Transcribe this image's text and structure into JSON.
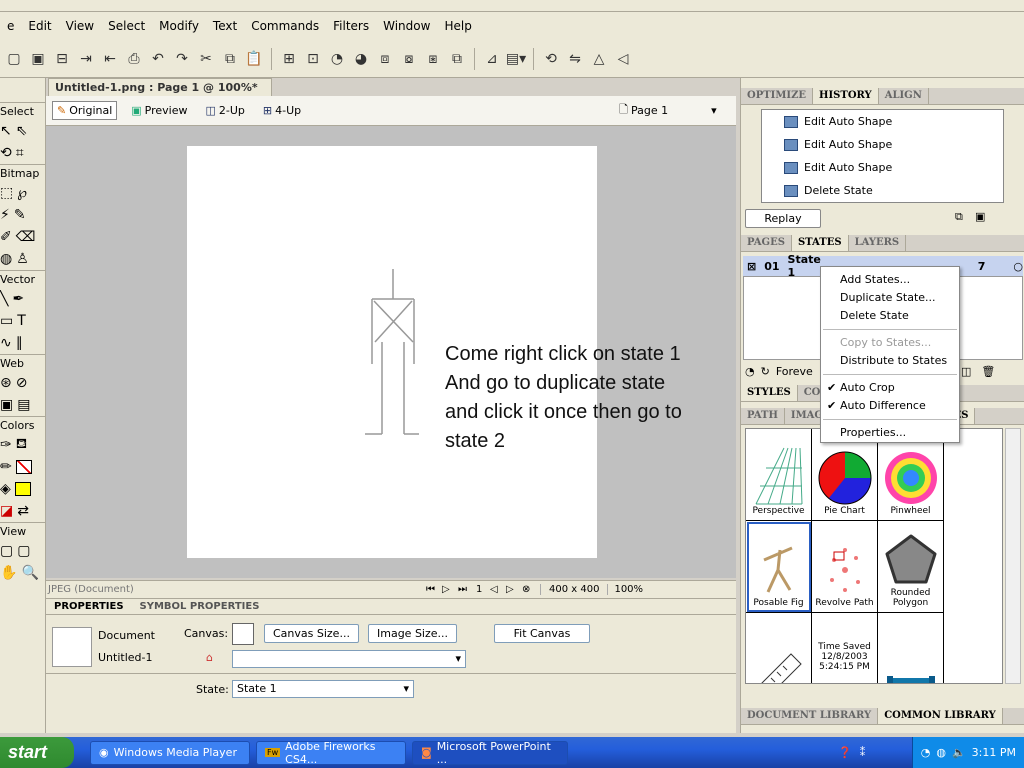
{
  "menu": [
    "e",
    "Edit",
    "View",
    "Select",
    "Modify",
    "Text",
    "Commands",
    "Filters",
    "Window",
    "Help"
  ],
  "document": {
    "tab_title": "Untitled-1.png : Page 1 @ 100%*",
    "close": "×",
    "view_original": "Original",
    "view_preview": "Preview",
    "view_2up": "2-Up",
    "view_4up": "4-Up",
    "page_selector": "Page 1"
  },
  "tools": {
    "select": "Select",
    "bitmap": "Bitmap",
    "vector": "Vector",
    "web": "Web",
    "colors": "Colors",
    "view": "View"
  },
  "annotation": [
    "Come right click on state 1",
    "And go to duplicate state",
    "and click it once then go to",
    "state 2"
  ],
  "status": {
    "format": "JPEG (Document)",
    "frame": "1",
    "size": "400 x 400",
    "zoom": "100%"
  },
  "properties": {
    "tab1": "PROPERTIES",
    "tab2": "SYMBOL PROPERTIES",
    "doc_label": "Document",
    "doc_name": "Untitled-1",
    "canvas_label": "Canvas:",
    "canvas_size_btn": "Canvas Size...",
    "image_size_btn": "Image Size...",
    "fit_canvas_btn": "Fit Canvas",
    "state_label": "State:",
    "state_value": "State 1"
  },
  "history_panel": {
    "tabs": [
      "OPTIMIZE",
      "HISTORY",
      "ALIGN"
    ],
    "active_tab": "HISTORY",
    "items": [
      "Edit Auto Shape",
      "Edit Auto Shape",
      "Edit Auto Shape",
      "Delete State"
    ],
    "replay": "Replay"
  },
  "states_panel": {
    "tabs": [
      "PAGES",
      "STATES",
      "LAYERS"
    ],
    "active_tab": "STATES",
    "state_num": "01",
    "state_name": "State 1",
    "delay": "7",
    "loop": "Foreve"
  },
  "styles_panel": {
    "tabs": [
      "STYLES",
      "COL"
    ]
  },
  "library_panel": {
    "tabs": [
      "PATH",
      "IMAGE",
      "ES"
    ],
    "items": [
      "Perspective",
      "Pie Chart",
      "Pinwheel",
      "Posable Fig",
      "Revolve Path",
      "Rounded Polygon",
      "",
      "Time Saved 12/8/2003 5:24:15 PM",
      ""
    ],
    "bottom_tabs": [
      "DOCUMENT LIBRARY",
      "COMMON LIBRARY"
    ]
  },
  "context_menu": [
    {
      "label": "Add States...",
      "disabled": false,
      "checked": false
    },
    {
      "label": "Duplicate State...",
      "disabled": false,
      "checked": false
    },
    {
      "label": "Delete State",
      "disabled": false,
      "checked": false
    },
    {
      "label": "Copy to States...",
      "disabled": true,
      "checked": false
    },
    {
      "label": "Distribute to States",
      "disabled": false,
      "checked": false
    },
    {
      "label": "Auto Crop",
      "disabled": false,
      "checked": true
    },
    {
      "label": "Auto Difference",
      "disabled": false,
      "checked": true
    },
    {
      "label": "Properties...",
      "disabled": false,
      "checked": false
    }
  ],
  "taskbar": {
    "start": "start",
    "tasks": [
      "Windows Media Player",
      "Adobe Fireworks CS4...",
      "Microsoft PowerPoint ..."
    ],
    "clock": "3:11 PM"
  },
  "colors": {
    "accent_blue": "#245edb",
    "start_green": "#3c9a3c",
    "selected_row": "#c6d3ef"
  }
}
